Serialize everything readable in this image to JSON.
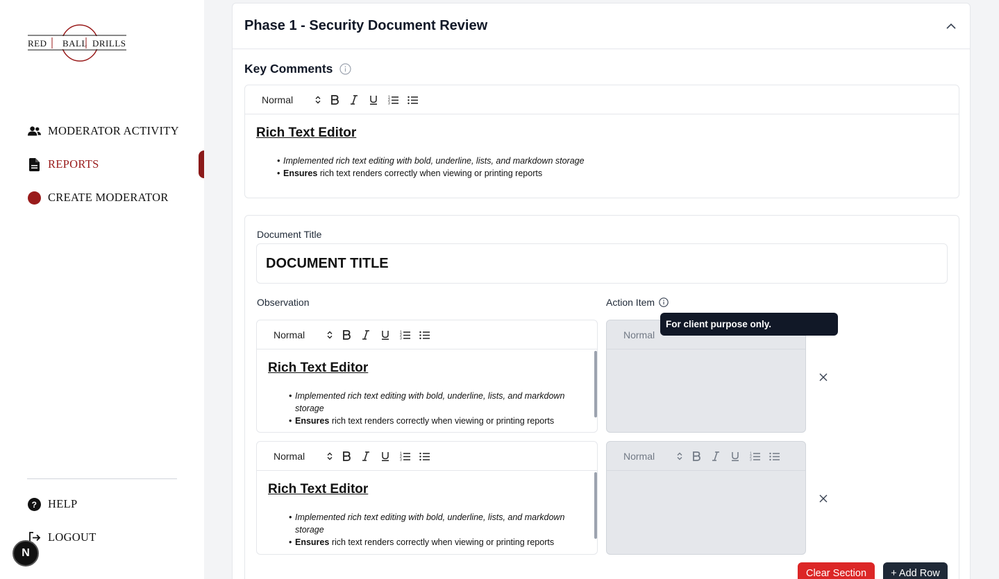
{
  "brand": {
    "logo_text_left": "RED",
    "logo_text_mid": "BALL",
    "logo_text_right": "DRILLS",
    "accent_color": "#991b1b"
  },
  "sidebar": {
    "items": [
      {
        "label": "MODERATOR ACTIVITY",
        "icon": "users-icon"
      },
      {
        "label": "REPORTS",
        "icon": "document-icon",
        "active": true
      },
      {
        "label": "CREATE MODERATOR",
        "icon": "red-circle-icon"
      }
    ],
    "bottom_items": [
      {
        "label": "HELP",
        "icon": "help-icon"
      },
      {
        "label": "LOGOUT",
        "icon": "logout-icon"
      }
    ],
    "badge": "N"
  },
  "section": {
    "title": "Phase 1 - Security Document Review",
    "key_comments_label": "Key Comments"
  },
  "editor": {
    "format_value": "Normal",
    "heading": "Rich Text Editor",
    "bullet_1": "Implemented rich text editing with bold, underline, lists, and markdown storage",
    "bullet_2_bold": "Ensures",
    "bullet_2_rest": " rich text renders correctly when viewing or printing reports"
  },
  "document": {
    "title_label": "Document Title",
    "title_value": "DOCUMENT TITLE",
    "observation_label": "Observation",
    "action_item_label": "Action Item",
    "tooltip": "For client purpose only."
  },
  "buttons": {
    "clear_section": "Clear Section",
    "add_row": "+ Add Row"
  }
}
